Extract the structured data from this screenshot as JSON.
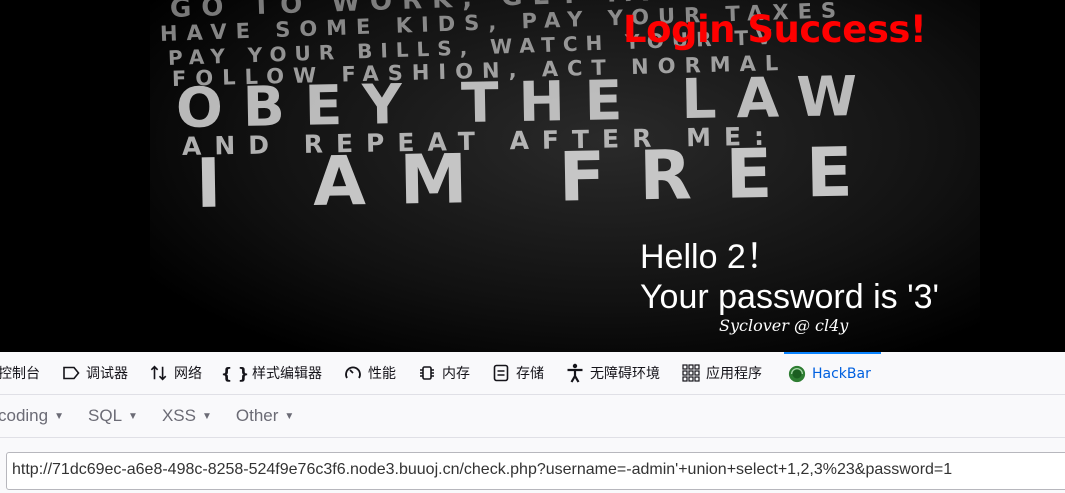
{
  "page": {
    "background_text": [
      "GO TO WORK, GET MARRIED",
      "HAVE SOME KIDS, PAY YOUR TAXES",
      "PAY YOUR BILLS, WATCH YOUR TV",
      "FOLLOW FASHION, ACT NORMAL",
      "OBEY THE LAW",
      "AND REPEAT AFTER ME:",
      "I AM FREE"
    ],
    "login_title": "Login Success!",
    "hello": "Hello 2！",
    "password_line": "Your password is '3'",
    "credit": "Syclover @ cl4y"
  },
  "devtools": {
    "tabs": [
      {
        "label": "控制台",
        "icon": "console-icon"
      },
      {
        "label": "调试器",
        "icon": "debugger-icon"
      },
      {
        "label": "网络",
        "icon": "network-icon"
      },
      {
        "label": "样式编辑器",
        "icon": "style-editor-icon"
      },
      {
        "label": "性能",
        "icon": "performance-icon"
      },
      {
        "label": "内存",
        "icon": "memory-icon"
      },
      {
        "label": "存储",
        "icon": "storage-icon"
      },
      {
        "label": "无障碍环境",
        "icon": "accessibility-icon"
      },
      {
        "label": "应用程序",
        "icon": "application-icon"
      },
      {
        "label": "HackBar",
        "icon": "hackbar-icon",
        "active": true
      }
    ],
    "hackbar_menus": [
      "coding",
      "SQL",
      "XSS",
      "Other"
    ],
    "url": "http://71dc69ec-a6e8-498c-8258-524f9e76c3f6.node3.buuoj.cn/check.php?username=-admin'+union+select+1,2,3%23&password=1"
  },
  "colors": {
    "title_red": "#ff0000",
    "active_tab": "#0060df",
    "active_indicator": "#0a84ff"
  }
}
